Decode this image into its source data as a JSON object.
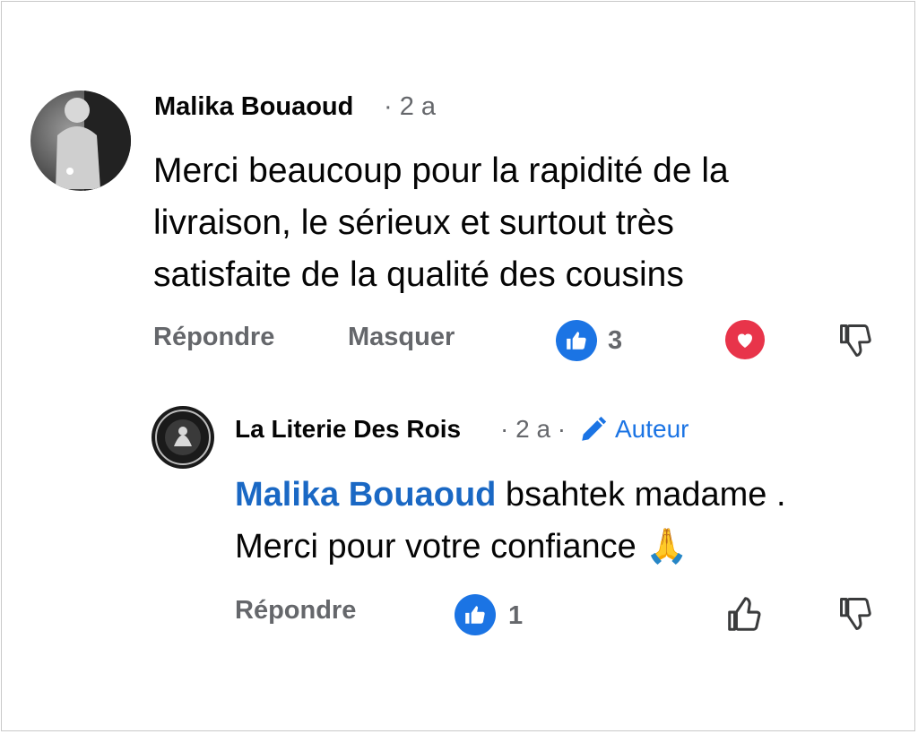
{
  "colors": {
    "like_blue": "#1b74e4",
    "love_red": "#e8344a",
    "link_blue": "#1a68c4",
    "muted_gray": "#65676b"
  },
  "comment": {
    "author": "Malika Bouaoud",
    "meta": "· 2 a",
    "lines": [
      "Merci beaucoup pour la rapidité de la",
      "livraison, le sérieux et surtout très",
      "satisfaite de la qualité des cousins"
    ],
    "actions": {
      "reply": "Répondre",
      "hide": "Masquer"
    },
    "reactions": {
      "like_count": "3",
      "icons": [
        "like-icon",
        "love-icon",
        "dislike-icon"
      ]
    }
  },
  "reply": {
    "author": "La Literie Des Rois",
    "meta": "· 2 a ·",
    "author_badge": "Auteur",
    "mention": "Malika Bouaoud",
    "line1_rest": " bsahtek madame .",
    "line2": "Merci pour votre confiance 🙏",
    "actions": {
      "reply": "Répondre"
    },
    "reactions": {
      "like_count": "1",
      "icons": [
        "like-icon",
        "thumbs-up-outline-icon",
        "dislike-icon"
      ]
    }
  }
}
